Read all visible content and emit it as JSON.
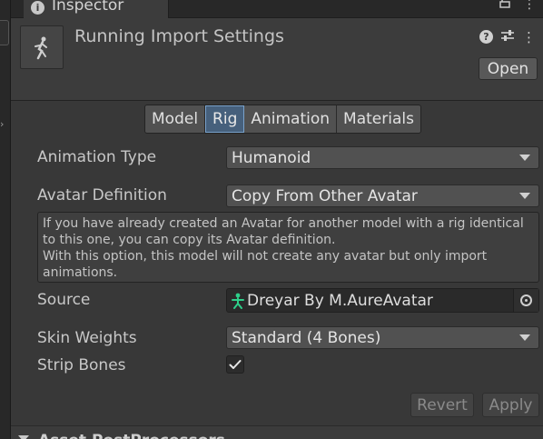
{
  "window": {
    "tab_label": "Inspector",
    "tab_icon": "info-icon"
  },
  "header": {
    "title": "Running Import Settings",
    "open_label": "Open",
    "thumbnail_icon": "running-figure-icon"
  },
  "tabs": [
    {
      "label": "Model",
      "active": false
    },
    {
      "label": "Rig",
      "active": true
    },
    {
      "label": "Animation",
      "active": false
    },
    {
      "label": "Materials",
      "active": false
    }
  ],
  "rig": {
    "animation_type": {
      "label": "Animation Type",
      "value": "Humanoid"
    },
    "avatar_definition": {
      "label": "Avatar Definition",
      "value": "Copy From Other Avatar"
    },
    "help": {
      "line1": "If you have already created an Avatar for another model with a rig identical",
      "line2": "to this one, you can copy its Avatar definition.",
      "line3": "With this option, this model will not create any avatar but only import",
      "line4": "animations."
    },
    "source": {
      "label": "Source",
      "value": "Dreyar By M.AureAvatar",
      "icon": "avatar-icon"
    },
    "skin_weights": {
      "label": "Skin Weights",
      "value": "Standard (4 Bones)"
    },
    "strip_bones": {
      "label": "Strip Bones",
      "checked": true
    }
  },
  "actions": {
    "revert_label": "Revert",
    "apply_label": "Apply"
  },
  "foldout": {
    "label": "Asset PostProcessors"
  },
  "colors": {
    "accent": "#46607c",
    "accent_border": "#7aa3cc",
    "avatar_icon": "#2ecf8a"
  }
}
